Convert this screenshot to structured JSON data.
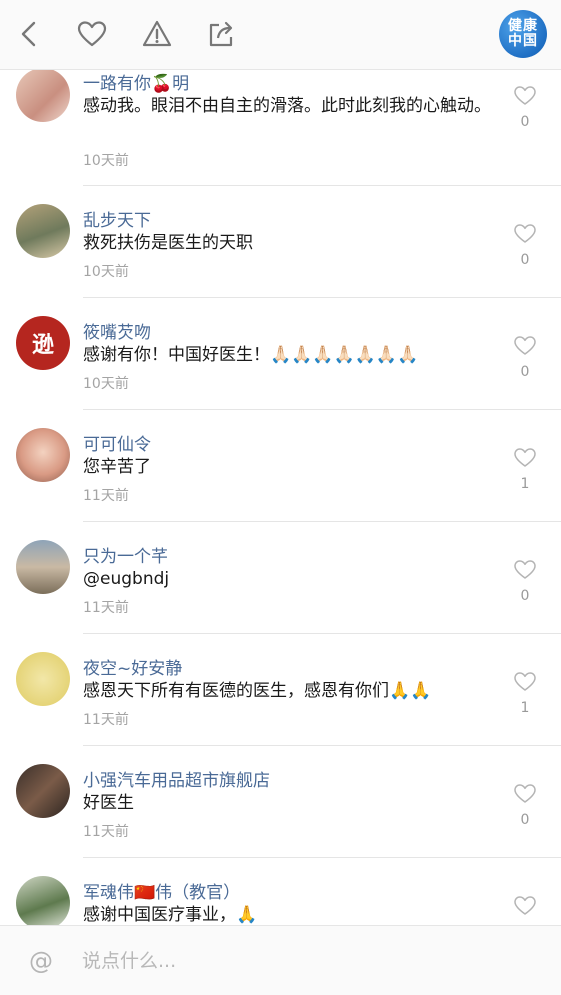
{
  "header": {
    "logo_line1": "健康",
    "logo_line2": "中国",
    "icons": [
      "back-icon",
      "heart-icon",
      "warning-icon",
      "share-icon"
    ]
  },
  "comments": [
    {
      "name": "一路有你🍒明",
      "text": "感动我。眼泪不由自主的滑落。此时此刻我的心触动。",
      "time": "10天前",
      "likes": "0"
    },
    {
      "name": "乱步天下",
      "text": "救死扶伤是医生的天职",
      "time": "10天前",
      "likes": "0"
    },
    {
      "name": "筱嘴芡吻",
      "text": "感谢有你！中国好医生！🙏🏻🙏🏻🙏🏻🙏🏻🙏🏻🙏🏻🙏🏻",
      "time": "10天前",
      "likes": "0",
      "avatar_text": "逊"
    },
    {
      "name": "可可仙令",
      "text": "您辛苦了",
      "time": "11天前",
      "likes": "1"
    },
    {
      "name": "只为一个芊",
      "text": "@eugbndj",
      "time": "11天前",
      "likes": "0"
    },
    {
      "name": "夜空~好安静",
      "text": "感恩天下所有有医德的医生，感恩有你们🙏🙏",
      "time": "11天前",
      "likes": "1"
    },
    {
      "name": "小强汽车用品超市旗舰店",
      "text": "好医生",
      "time": "11天前",
      "likes": "0"
    },
    {
      "name": "军魂伟🇨🇳伟（教官）",
      "text": "感谢中国医疗事业，🙏",
      "time": "",
      "likes": ""
    }
  ],
  "composer": {
    "placeholder": "说点什么..."
  },
  "colors": {
    "name": "#4a6a96",
    "time": "#a4a4a4",
    "logo": "#1f6fc4"
  }
}
